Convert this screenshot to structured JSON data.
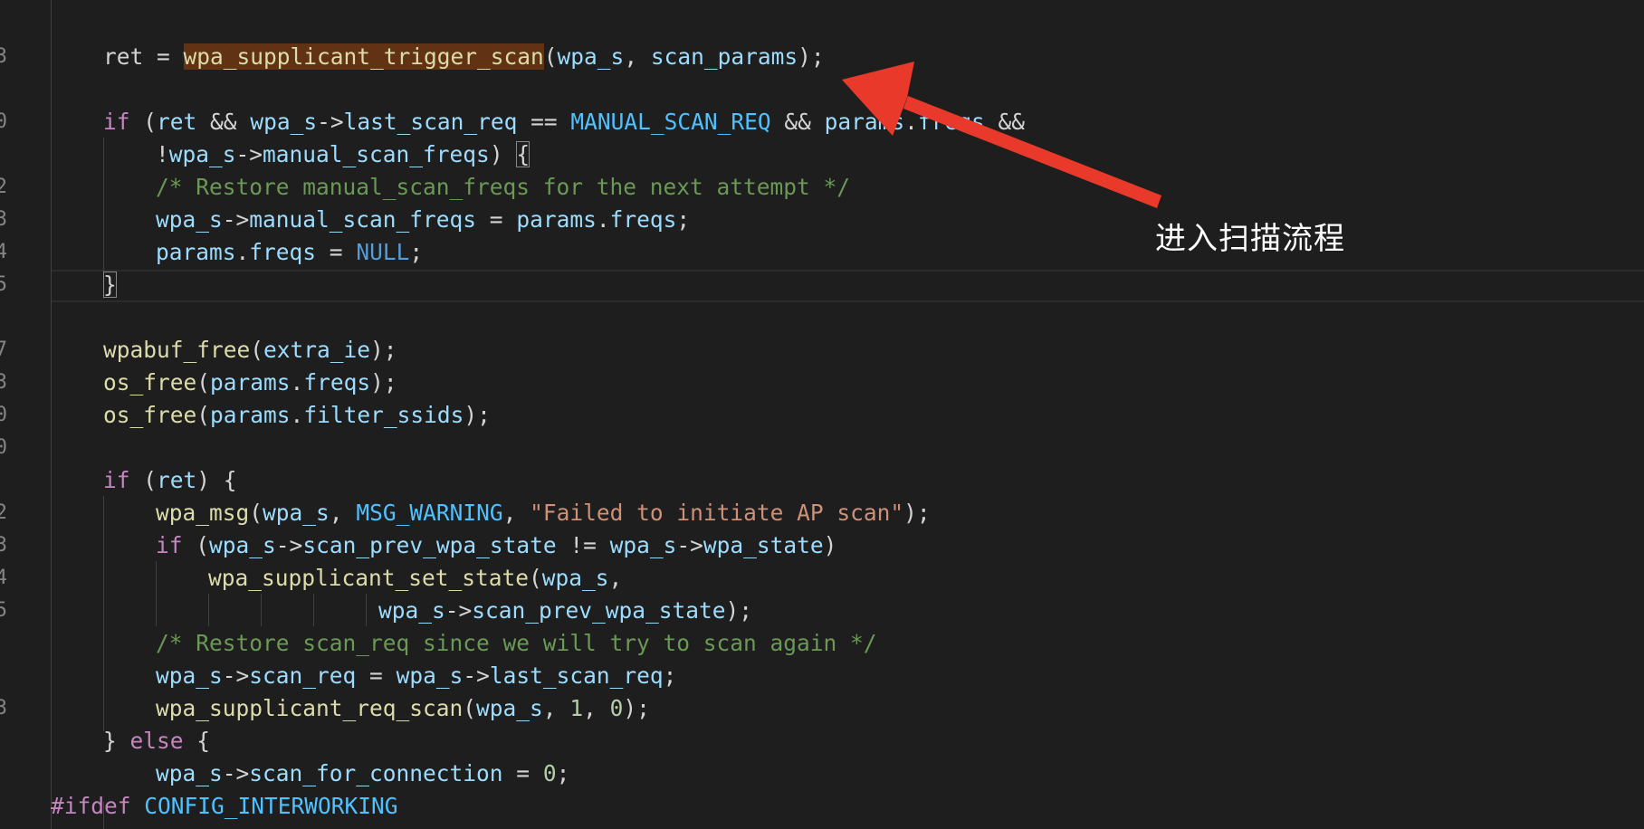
{
  "editor": {
    "lines": [
      {
        "n": "3",
        "segs": [
          [
            "punc",
            "ret = "
          ],
          [
            "hl",
            "wpa_supplicant_trigger_scan"
          ],
          [
            "punc",
            "("
          ],
          [
            "var",
            "wpa_s"
          ],
          [
            "punc",
            ", "
          ],
          [
            "var",
            "scan_params"
          ],
          [
            "punc",
            ");"
          ]
        ]
      },
      {
        "n": "",
        "segs": []
      },
      {
        "n": "0",
        "segs": [
          [
            "kw",
            "if"
          ],
          [
            "punc",
            " ("
          ],
          [
            "var",
            "ret"
          ],
          [
            "punc",
            " && "
          ],
          [
            "var",
            "wpa_s"
          ],
          [
            "punc",
            "->"
          ],
          [
            "var",
            "last_scan_req"
          ],
          [
            "punc",
            " == "
          ],
          [
            "const",
            "MANUAL_SCAN_REQ"
          ],
          [
            "punc",
            " && "
          ],
          [
            "var",
            "params"
          ],
          [
            "punc",
            "."
          ],
          [
            "var",
            "freqs"
          ],
          [
            "punc",
            " &&"
          ]
        ]
      },
      {
        "n": "",
        "segs": [
          [
            "punc",
            "!"
          ],
          [
            "var",
            "wpa_s"
          ],
          [
            "punc",
            "->"
          ],
          [
            "var",
            "manual_scan_freqs"
          ],
          [
            "punc",
            ") {"
          ]
        ]
      },
      {
        "n": "2",
        "segs": [
          [
            "cmt",
            "/* Restore manual_scan_freqs for the next attempt */"
          ]
        ]
      },
      {
        "n": "3",
        "segs": [
          [
            "var",
            "wpa_s"
          ],
          [
            "punc",
            "->"
          ],
          [
            "var",
            "manual_scan_freqs"
          ],
          [
            "punc",
            " = "
          ],
          [
            "var",
            "params"
          ],
          [
            "punc",
            "."
          ],
          [
            "var",
            "freqs"
          ],
          [
            "punc",
            ";"
          ]
        ]
      },
      {
        "n": "4",
        "segs": [
          [
            "var",
            "params"
          ],
          [
            "punc",
            "."
          ],
          [
            "var",
            "freqs"
          ],
          [
            "punc",
            " = "
          ],
          [
            "ltrl",
            "NULL"
          ],
          [
            "punc",
            ";"
          ]
        ]
      },
      {
        "n": "5",
        "segs": [
          [
            "punc",
            "}"
          ]
        ]
      },
      {
        "n": "",
        "segs": []
      },
      {
        "n": "7",
        "segs": [
          [
            "fn",
            "wpabuf_free"
          ],
          [
            "punc",
            "("
          ],
          [
            "var",
            "extra_ie"
          ],
          [
            "punc",
            ");"
          ]
        ]
      },
      {
        "n": "3",
        "segs": [
          [
            "fn",
            "os_free"
          ],
          [
            "punc",
            "("
          ],
          [
            "var",
            "params"
          ],
          [
            "punc",
            "."
          ],
          [
            "var",
            "freqs"
          ],
          [
            "punc",
            ");"
          ]
        ]
      },
      {
        "n": "0",
        "segs": [
          [
            "fn",
            "os_free"
          ],
          [
            "punc",
            "("
          ],
          [
            "var",
            "params"
          ],
          [
            "punc",
            "."
          ],
          [
            "var",
            "filter_ssids"
          ],
          [
            "punc",
            ");"
          ]
        ]
      },
      {
        "n": "0",
        "segs": []
      },
      {
        "n": "",
        "segs": [
          [
            "kw",
            "if"
          ],
          [
            "punc",
            " ("
          ],
          [
            "var",
            "ret"
          ],
          [
            "punc",
            ") {"
          ]
        ]
      },
      {
        "n": "2",
        "segs": [
          [
            "fn",
            "wpa_msg"
          ],
          [
            "punc",
            "("
          ],
          [
            "var",
            "wpa_s"
          ],
          [
            "punc",
            ", "
          ],
          [
            "const",
            "MSG_WARNING"
          ],
          [
            "punc",
            ", "
          ],
          [
            "str",
            "\"Failed to initiate AP scan\""
          ],
          [
            "punc",
            ");"
          ]
        ]
      },
      {
        "n": "3",
        "segs": [
          [
            "kw",
            "if"
          ],
          [
            "punc",
            " ("
          ],
          [
            "var",
            "wpa_s"
          ],
          [
            "punc",
            "->"
          ],
          [
            "var",
            "scan_prev_wpa_state"
          ],
          [
            "punc",
            " != "
          ],
          [
            "var",
            "wpa_s"
          ],
          [
            "punc",
            "->"
          ],
          [
            "var",
            "wpa_state"
          ],
          [
            "punc",
            ")"
          ]
        ]
      },
      {
        "n": "4",
        "segs": [
          [
            "fn",
            "wpa_supplicant_set_state"
          ],
          [
            "punc",
            "("
          ],
          [
            "var",
            "wpa_s"
          ],
          [
            "punc",
            ","
          ]
        ]
      },
      {
        "n": "5",
        "segs": [
          [
            "var",
            "wpa_s"
          ],
          [
            "punc",
            "->"
          ],
          [
            "var",
            "scan_prev_wpa_state"
          ],
          [
            "punc",
            ");"
          ]
        ]
      },
      {
        "n": "",
        "segs": [
          [
            "cmt",
            "/* Restore scan_req since we will try to scan again */"
          ]
        ]
      },
      {
        "n": "",
        "segs": [
          [
            "var",
            "wpa_s"
          ],
          [
            "punc",
            "->"
          ],
          [
            "var",
            "scan_req"
          ],
          [
            "punc",
            " = "
          ],
          [
            "var",
            "wpa_s"
          ],
          [
            "punc",
            "->"
          ],
          [
            "var",
            "last_scan_req"
          ],
          [
            "punc",
            ";"
          ]
        ]
      },
      {
        "n": "3",
        "segs": [
          [
            "fn",
            "wpa_supplicant_req_scan"
          ],
          [
            "punc",
            "("
          ],
          [
            "var",
            "wpa_s"
          ],
          [
            "punc",
            ", "
          ],
          [
            "num",
            "1"
          ],
          [
            "punc",
            ", "
          ],
          [
            "num",
            "0"
          ],
          [
            "punc",
            ");"
          ]
        ]
      },
      {
        "n": "",
        "segs": [
          [
            "punc",
            "} "
          ],
          [
            "kw",
            "else"
          ],
          [
            "punc",
            " {"
          ]
        ]
      },
      {
        "n": "",
        "segs": [
          [
            "var",
            "wpa_s"
          ],
          [
            "punc",
            "->"
          ],
          [
            "var",
            "scan_for_connection"
          ],
          [
            "punc",
            " = "
          ],
          [
            "num",
            "0"
          ],
          [
            "punc",
            ";"
          ]
        ]
      },
      {
        "n": "",
        "segs": [
          [
            "pre",
            "#ifdef"
          ],
          [
            "punc",
            " "
          ],
          [
            "const",
            "CONFIG_INTERWORKING"
          ]
        ]
      }
    ]
  },
  "annotation": {
    "text": "进入扫描流程",
    "arrow_color": "#e8392a"
  }
}
